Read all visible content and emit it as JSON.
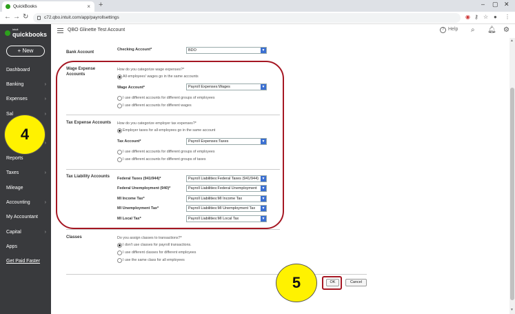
{
  "browser": {
    "tab_title": "QuickBooks",
    "tab_close": "×",
    "new_tab": "+",
    "url": "c72.qbo.intuit.com/app/payrollsettings"
  },
  "sidebar": {
    "logo_small": "intuit",
    "logo": "quickbooks",
    "new_button": "+ New",
    "items": [
      {
        "label": "Dashboard",
        "chevron": ""
      },
      {
        "label": "Banking",
        "chevron": "›"
      },
      {
        "label": "Expenses",
        "chevron": "›"
      },
      {
        "label": "Sal",
        "chevron": "›"
      },
      {
        "label": "W",
        "chevron": "›"
      },
      {
        "label": "Reports",
        "chevron": ""
      },
      {
        "label": "Taxes",
        "chevron": "›"
      },
      {
        "label": "Mileage",
        "chevron": ""
      },
      {
        "label": "Accounting",
        "chevron": "›"
      },
      {
        "label": "My Accountant",
        "chevron": ""
      },
      {
        "label": "Capital",
        "chevron": "›"
      },
      {
        "label": "Apps",
        "chevron": ""
      },
      {
        "label": "Get Paid Faster",
        "chevron": ""
      }
    ]
  },
  "header": {
    "company": "QBO Glinette Test Account",
    "help": "Help",
    "help_glyph": "?"
  },
  "bank": {
    "section": "Bank Account",
    "field_label": "Checking Account*",
    "value": "BDO"
  },
  "wage": {
    "section": "Wage Expense Accounts",
    "question": "How do you categorize wage expenses?*",
    "opt_same": "All employees' wages go in the same accounts",
    "field_label": "Wage Account*",
    "value": "Payroll Expenses:Wages",
    "opt_groups": "I use different accounts for different groups of employees",
    "opt_wages": "I use different accounts for different wages"
  },
  "tax_expense": {
    "section": "Tax Expense Accounts",
    "question": "How do you categorize employer tax expenses?*",
    "opt_same": "Employer taxes for all employees go in the same account",
    "field_label": "Tax Account*",
    "value": "Payroll Expenses:Taxes",
    "opt_groups": "I use different accounts for different groups of employees",
    "opt_taxes": "I use different accounts for different groups of taxes"
  },
  "tax_liability": {
    "section": "Tax Liability Accounts",
    "rows": [
      {
        "label": "Federal Taxes (941/944)*",
        "value": "Payroll Liabilities:Federal Taxes (941/944)"
      },
      {
        "label": "Federal Unemployment (940)*",
        "value": "Payroll Liabilities:Federal Unemployment"
      },
      {
        "label": "MI Income Tax*",
        "value": "Payroll Liabilities:MI Income Tax"
      },
      {
        "label": "MI Unemployment Tax*",
        "value": "Payroll Liabilities:MI Unemployment Tax"
      },
      {
        "label": "MI Local Tax*",
        "value": "Payroll Liabilities:MI Local Tax"
      }
    ]
  },
  "classes": {
    "section": "Classes",
    "question": "Do you assign classes to transactions?*",
    "opt_none": "I don't use classes for payroll transactions.",
    "opt_groups": "I use different classes for different employees",
    "opt_same": "I use the same class for all employees"
  },
  "buttons": {
    "ok": "OK",
    "cancel": "Cancel"
  },
  "annotations": {
    "step4": "4",
    "step5": "5",
    "color": "#a51622",
    "badge_color": "#fff200"
  }
}
